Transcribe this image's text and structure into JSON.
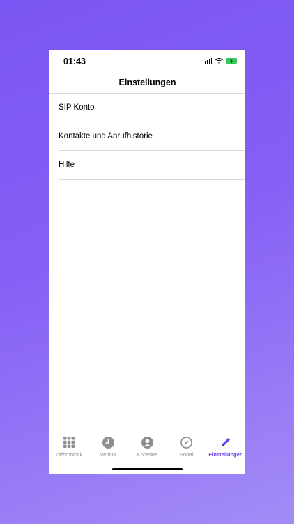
{
  "status_bar": {
    "time": "01:43"
  },
  "nav": {
    "title": "Einstellungen"
  },
  "settings": {
    "items": [
      {
        "label": "SIP Konto"
      },
      {
        "label": "Kontakte und Anrufhistorie"
      },
      {
        "label": "Hilfe"
      }
    ]
  },
  "tab_bar": {
    "tabs": [
      {
        "label": "Ziffernblock",
        "icon": "keypad-icon"
      },
      {
        "label": "Verlauf",
        "icon": "clock-icon"
      },
      {
        "label": "Kontakte",
        "icon": "person-icon"
      },
      {
        "label": "Portal",
        "icon": "compass-icon"
      },
      {
        "label": "Einstellungen",
        "icon": "pencil-icon",
        "active": true
      }
    ]
  },
  "colors": {
    "accent": "#6a45e6",
    "inactive": "#8e8e8e",
    "battery": "#34c759"
  }
}
